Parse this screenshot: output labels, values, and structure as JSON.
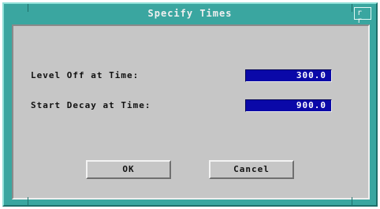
{
  "window": {
    "title": "Specify Times",
    "menu_glyph": "r",
    "maximize_glyph": "r r"
  },
  "fields": [
    {
      "label": "Level Off at Time:",
      "value": "300.0"
    },
    {
      "label": "Start Decay at Time:",
      "value": "900.0"
    }
  ],
  "buttons": {
    "ok_label": "OK",
    "cancel_label": "Cancel"
  },
  "colors": {
    "frame": "#3aa6a0",
    "panel": "#c6c6c6",
    "field_bg": "#0a08a8",
    "field_text": "#ffffff"
  },
  "icons": {
    "window_menu": "window-menu-icon",
    "maximize": "maximize-icon"
  }
}
